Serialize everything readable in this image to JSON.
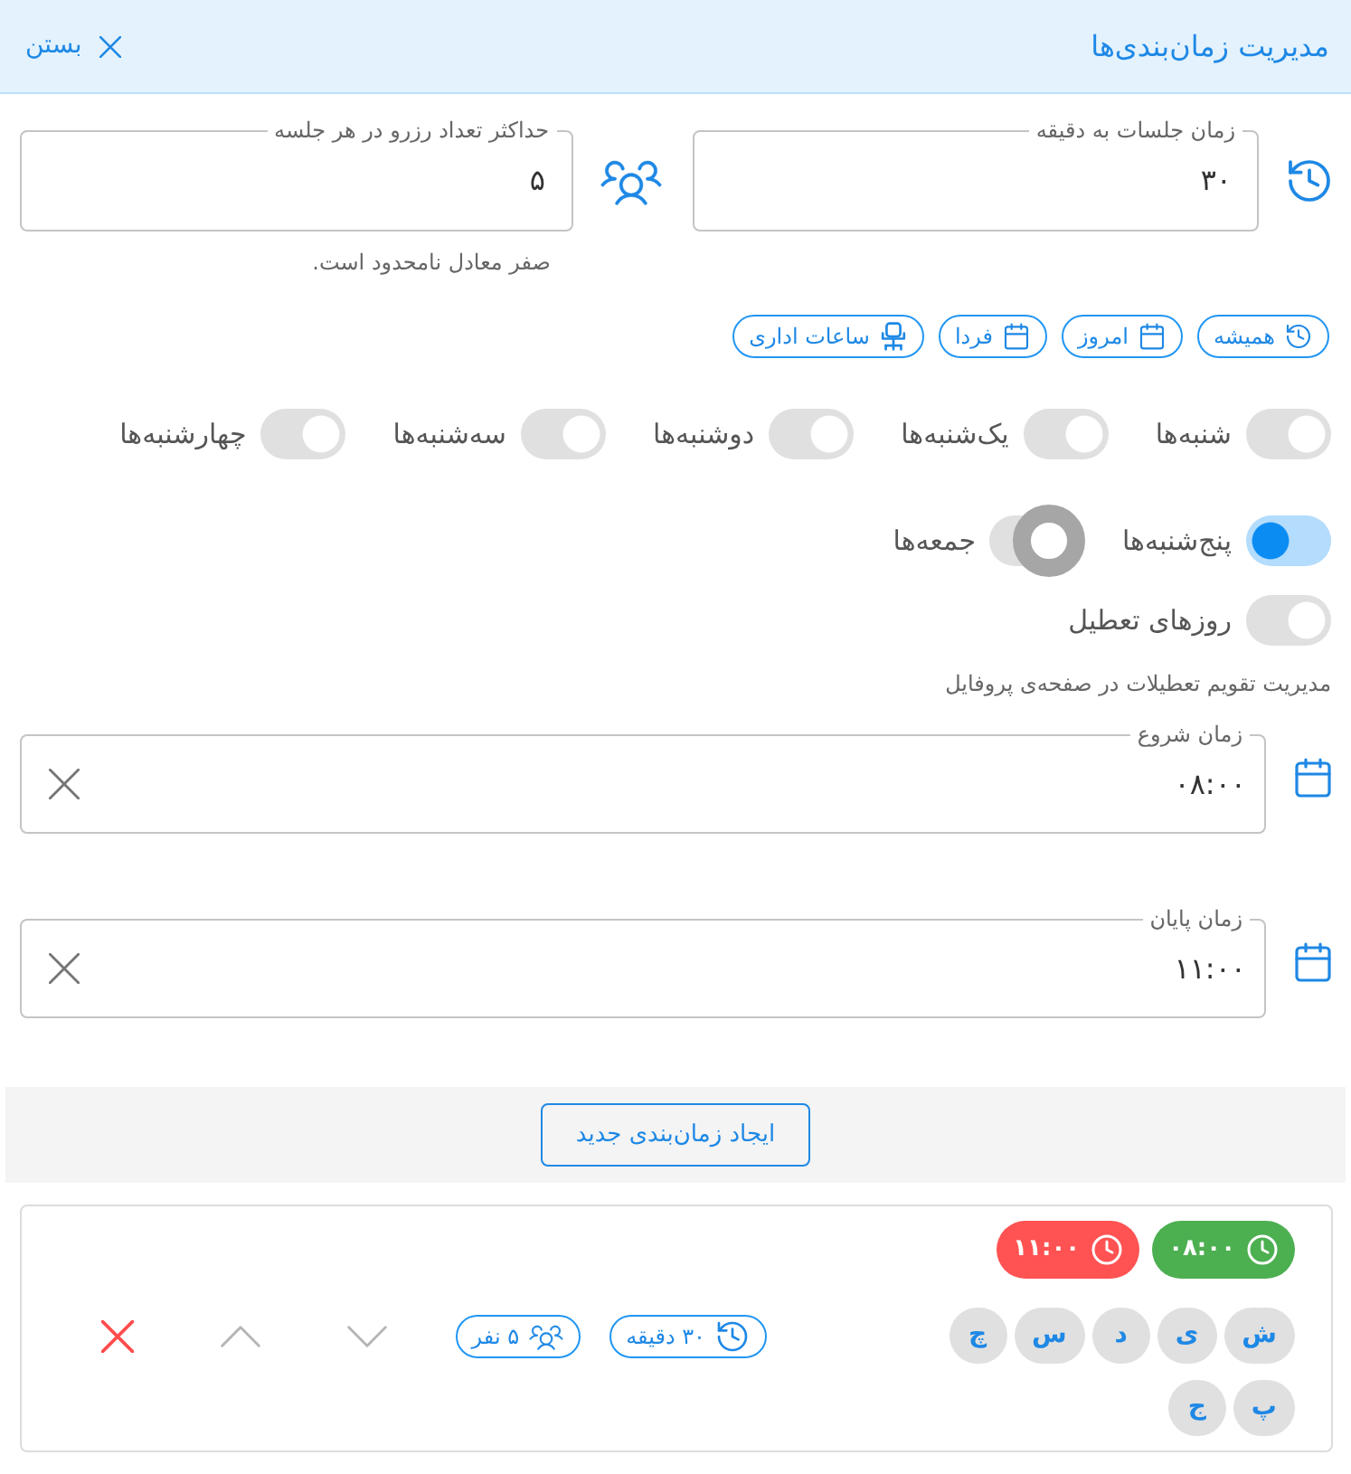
{
  "header": {
    "title": "مدیریت زمان‌بندی‌ها",
    "close_label": "بستن"
  },
  "settings": [
    {
      "kind": "duration",
      "label": "زمان جلسات به دقیقه",
      "value": "۳۰"
    },
    {
      "kind": "capacity",
      "label": "حداکثر تعداد رزرو در هر جلسه",
      "value": "۵",
      "helper": "صفر معادل نامحدود است."
    }
  ],
  "presets": [
    {
      "kind": "history",
      "label": "همیشه"
    },
    {
      "kind": "calendar",
      "label": "امروز"
    },
    {
      "kind": "calendar",
      "label": "فردا"
    },
    {
      "kind": "chair",
      "label": "ساعات اداری"
    }
  ],
  "weekdays": [
    {
      "label": "شنبه‌ها",
      "on": false,
      "focused": false
    },
    {
      "label": "یک‌شنبه‌ها",
      "on": false,
      "focused": false
    },
    {
      "label": "دوشنبه‌ها",
      "on": false,
      "focused": false
    },
    {
      "label": "سه‌شنبه‌ها",
      "on": false,
      "focused": false
    },
    {
      "label": "چهارشنبه‌ها",
      "on": false,
      "focused": false
    },
    {
      "label": "پنج‌شنبه‌ها",
      "on": true,
      "focused": false
    },
    {
      "label": "جمعه‌ها",
      "on": false,
      "focused": true
    }
  ],
  "holidays": {
    "label": "روزهای تعطیل",
    "on": false,
    "focused": false,
    "helper": "مدیریت تقویم تعطیلات در صفحه‌ی پروفایل"
  },
  "time_fields": [
    {
      "label": "زمان شروع",
      "value": "۰۸:۰۰"
    },
    {
      "label": "زمان پایان",
      "value": "۱۱:۰۰"
    }
  ],
  "create_button": "ایجاد زمان‌بندی جدید",
  "schedules": [
    {
      "times": [
        {
          "label": "۰۸:۰۰",
          "color": "#4caf50"
        },
        {
          "label": "۱۱:۰۰",
          "color": "#ff5252"
        }
      ],
      "days": [
        "ش",
        "ی",
        "د",
        "س",
        "چ",
        "پ",
        "ج"
      ],
      "badges": [
        {
          "kind": "duration",
          "label": "۳۰ دقیقه"
        },
        {
          "kind": "capacity",
          "label": "۵ نفر"
        }
      ],
      "actions": [
        {
          "kind": "move_down",
          "disabled": true
        },
        {
          "kind": "move_up",
          "disabled": true
        },
        {
          "kind": "delete",
          "disabled": false
        }
      ]
    }
  ]
}
